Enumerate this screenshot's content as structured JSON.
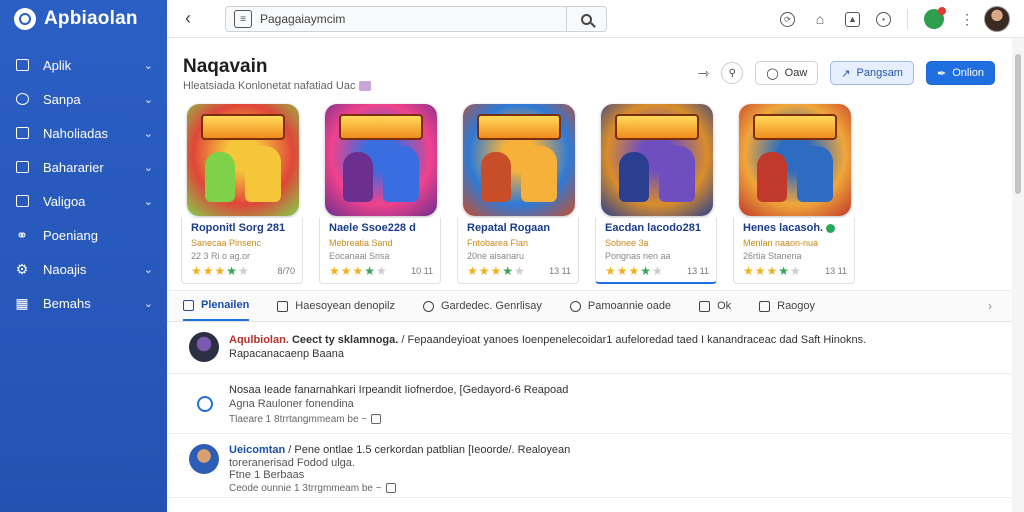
{
  "app": {
    "name": "Apbiaolan"
  },
  "sidebar": {
    "items": [
      {
        "label": "Aplik",
        "has_chevron": true
      },
      {
        "label": "Sanpa",
        "has_chevron": true
      },
      {
        "label": "Naholiadas",
        "has_chevron": true
      },
      {
        "label": "Bahararier",
        "has_chevron": true
      },
      {
        "label": "Valigoa",
        "has_chevron": true
      },
      {
        "label": "Poeniang",
        "has_chevron": false
      },
      {
        "label": "Naoajis",
        "has_chevron": true
      },
      {
        "label": "Bemahs",
        "has_chevron": true
      }
    ]
  },
  "topbar": {
    "search": {
      "value": "Pagagaiaymcim",
      "placeholder": "Pagagaiaymcim"
    }
  },
  "section": {
    "title": "Naqavain",
    "subtitle": "Hleatsiada Konlonetat nafatiad Uac",
    "actions": {
      "watch_label": "Oaw",
      "program_label": "Pangsam",
      "primary_label": "Onlion"
    }
  },
  "cards": [
    {
      "banner": "SNKIIR RKLLNAS",
      "name": "Roponitl Sorg 281",
      "desc": "Sanecaa Pinsenc",
      "meta": "22 3 Ri o ag.or",
      "rating": 4,
      "size": "8/70",
      "colors": [
        "#7fd14a",
        "#e0463a",
        "#f5c53a"
      ]
    },
    {
      "banner": "NAUSH KOKEBOSIA",
      "name": "Naele Ssoe228 d",
      "desc": "Mebreatia Sand",
      "meta": "Eocanaai Snsa",
      "rating": 4,
      "size": "10 11",
      "colors": [
        "#6b2f8f",
        "#f0428c",
        "#3a6de0"
      ]
    },
    {
      "banner": "REDISAN",
      "name": "Repatal Rogaan",
      "desc": "Fntobarea Flan",
      "meta": "20ne aisanaru",
      "rating": 4,
      "size": "13 11",
      "colors": [
        "#c84e2a",
        "#2f7ad6",
        "#f5b13a"
      ]
    },
    {
      "banner": "NIDBAISIB",
      "name": "Eacdan lacodo281",
      "desc": "Sobnee 3a",
      "meta": "Pongnas nen aa",
      "rating": 4,
      "size": "13 11",
      "colors": [
        "#2a3f8f",
        "#d98d2a",
        "#6f4fbf"
      ]
    },
    {
      "banner": "BLAGOLTAL",
      "name": "Henes lacasoh.",
      "desc": "Menlan naaon-nua",
      "meta": "26rtia Stanena",
      "rating": 4,
      "size": "13 11",
      "verified": true,
      "colors": [
        "#c0392b",
        "#f0a63a",
        "#2d6cc0"
      ]
    }
  ],
  "active_card": 3,
  "tabs": [
    {
      "label": "Plenailen",
      "active": true
    },
    {
      "label": "Haesoyean denopilz",
      "active": false
    },
    {
      "label": "Gardedec. Genrlisay",
      "active": false
    },
    {
      "label": "Pamoannie oade",
      "active": false
    },
    {
      "label": "Ok",
      "active": false
    },
    {
      "label": "Raogoy",
      "active": false
    }
  ],
  "posts": [
    {
      "author": "Aqulbiolan.",
      "headline": "Ceect ty sklamnoga.",
      "text": " / Fepaandeyioat yanoes Ioenpenelecoidar1 aufeloredad taed I kanandraceac dad Saft Hinokns.",
      "sub": "Rapacanacaenp Baana"
    },
    {
      "line1": "Nosaa Ieade fanarnahkari Irpeandit Iiofnerdoe, [Gedayord-6 Reapoad",
      "line2": "Agna Rauloner fonendina",
      "meta": "Tlaeare 1 8trrtangmmeam be ~"
    },
    {
      "author": "Ueicomtan",
      "text": " / Pene ontlae 1.5 cerkordan patblian [Ieoorde/. Realoyean",
      "line2": "toreranerisad Fodod ulga.",
      "line3": "Ftne 1 Berbaas",
      "meta": "Ceode ounnie 1 3trrgmmeam be ~"
    }
  ]
}
